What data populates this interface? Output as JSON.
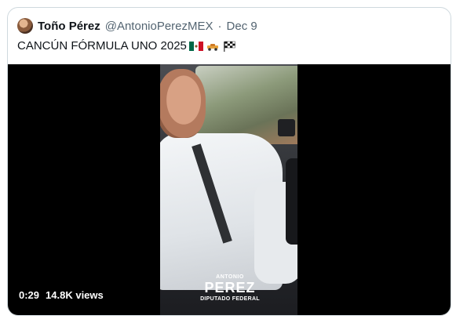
{
  "tweet": {
    "display_name": "Toño Pérez",
    "handle": "@AntonioPerezMEX",
    "separator": "·",
    "date": "Dec 9",
    "text": "CANCÚN FÓRMULA UNO 2025",
    "emojis": [
      "mexico-flag-icon",
      "race-car-icon",
      "checkered-flag-icon"
    ]
  },
  "video": {
    "duration": "0:29",
    "views": "14.8K views",
    "watermark": {
      "top": "ANTONIO",
      "main": "PEREZ",
      "sub": "DIPUTADO FEDERAL"
    }
  }
}
